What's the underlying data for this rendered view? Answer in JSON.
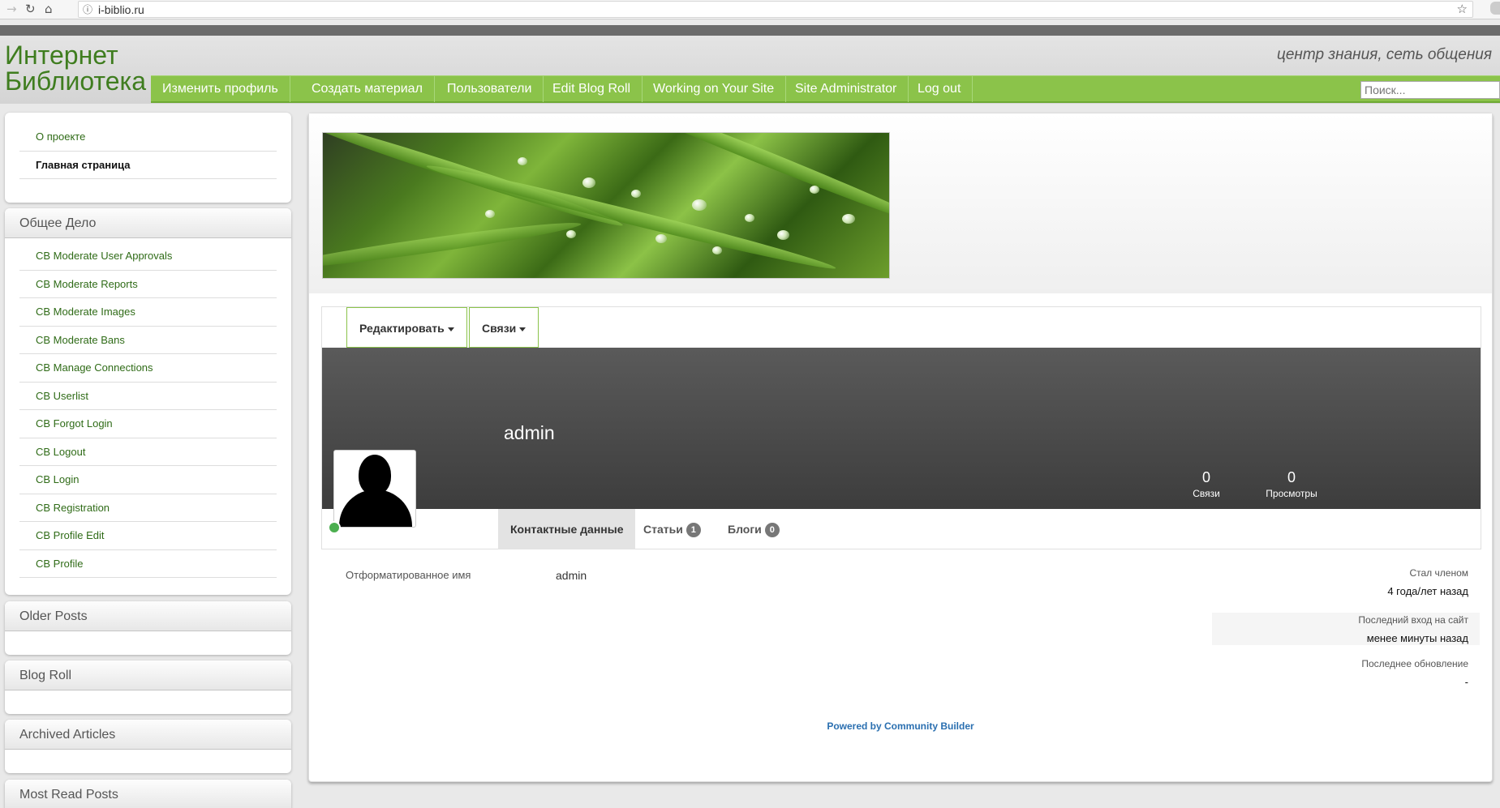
{
  "browser": {
    "url": "i-biblio.ru"
  },
  "site": {
    "logo": "Интернет Библиотека",
    "tagline": "центр знания, сеть общения",
    "menu": [
      "Изменить профиль",
      "Создать материал",
      "Пользователи",
      "Edit Blog Roll",
      "Working on Your Site",
      "Site Administrator",
      "Log out"
    ],
    "search_placeholder": "Поиск..."
  },
  "sidebar": {
    "top_links": [
      "О проекте",
      "Главная страница"
    ],
    "common_title": "Общее Дело",
    "common_links": [
      "CB Moderate User Approvals",
      "CB Moderate Reports",
      "CB Moderate Images",
      "CB Moderate Bans",
      "CB Manage Connections",
      "CB Userlist",
      "CB Forgot Login",
      "CB Logout",
      "CB Login",
      "CB Registration",
      "CB Profile Edit",
      "CB Profile"
    ],
    "older_posts": "Older Posts",
    "blog_roll": "Blog Roll",
    "archived": "Archived Articles",
    "most_read": "Most Read Posts"
  },
  "profile": {
    "edit_button": "Редактировать",
    "connections_button": "Связи",
    "username": "admin",
    "stats": [
      {
        "value": "0",
        "label": "Связи"
      },
      {
        "value": "0",
        "label": "Просмотры"
      }
    ],
    "tabs": [
      {
        "label": "Контактные данные",
        "badge": ""
      },
      {
        "label": "Статьи",
        "badge": "1"
      },
      {
        "label": "Блоги",
        "badge": "0"
      }
    ],
    "formatted_name_label": "Отформатированное имя",
    "formatted_name_value": "admin",
    "member_since_label": "Стал членом",
    "member_since_value": "4 года/лет назад",
    "last_login_label": "Последний вход на сайт",
    "last_login_value": "менее минуты назад",
    "last_update_label": "Последнее обновление",
    "last_update_value": "-",
    "powered_by": "Powered by Community Builder"
  },
  "colors": {
    "menu_green": "#8bc34a",
    "logo_green": "#3f7d1f",
    "online": "#4caf50"
  }
}
